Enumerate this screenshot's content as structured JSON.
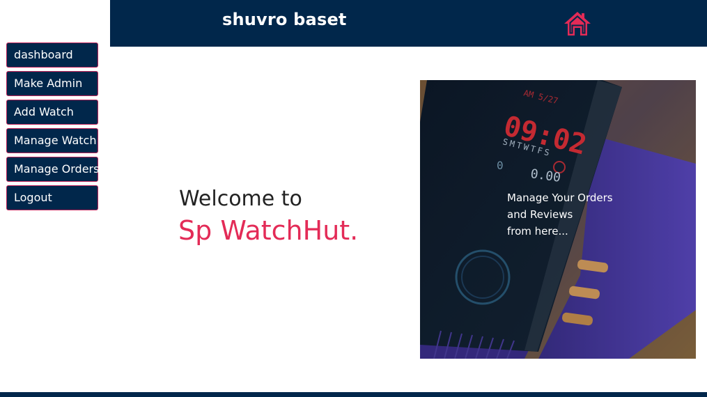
{
  "header": {
    "user_name": "shuvro baset",
    "home_icon": "home-icon",
    "home_icon_color": "#e32b57",
    "background": "#01274b"
  },
  "sidebar": {
    "items": [
      {
        "label": "dashboard"
      },
      {
        "label": "Make Admin"
      },
      {
        "label": "Add Watch"
      },
      {
        "label": "Manage Watch"
      },
      {
        "label": "Manage Orders"
      },
      {
        "label": "Logout"
      }
    ],
    "button_color": "#01274b",
    "border_color": "#c0245a"
  },
  "main": {
    "welcome": "Welcome to",
    "brand": "Sp WatchHut.",
    "brand_color": "#e32b57"
  },
  "hero": {
    "image": "smartwatch-photo",
    "overlay_lines": [
      "Manage Your Orders",
      "and Reviews",
      "from here..."
    ],
    "watch_display": {
      "date": "AM 5/27",
      "time": "09:02",
      "days": "SMTWTFS",
      "left_value": "0",
      "right_value": "0.00"
    }
  }
}
